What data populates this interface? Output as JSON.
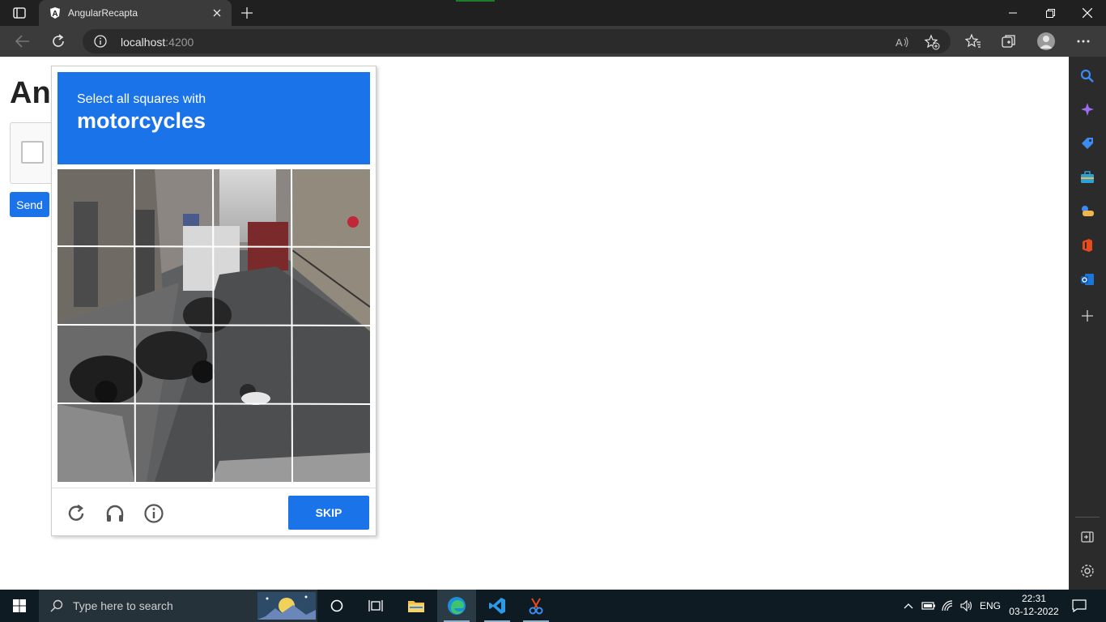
{
  "browser": {
    "tab_title": "AngularRecapta",
    "url_host": "localhost",
    "url_port": ":4200"
  },
  "page": {
    "heading": "An",
    "send_label": "Send"
  },
  "challenge": {
    "instruction": "Select all squares with",
    "target": "motorcycles",
    "skip_label": "SKIP",
    "tile_count": 16
  },
  "taskbar": {
    "search_placeholder": "Type here to search",
    "language": "ENG",
    "time": "22:31",
    "date": "03-12-2022"
  },
  "icons": {
    "sidebar": [
      "search-icon",
      "copilot-icon",
      "shopping-icon",
      "tools-icon",
      "games-icon",
      "office-icon",
      "outlook-icon",
      "add-icon",
      "hide-sidebar-icon",
      "settings-icon"
    ],
    "toolbar": [
      "read-aloud-icon",
      "add-favorite-icon",
      "favorites-icon",
      "collections-icon",
      "profile-icon",
      "more-icon"
    ]
  },
  "colors": {
    "accent": "#1a73e8",
    "titlebar": "#202020",
    "taskbar": "#0f1b22"
  }
}
